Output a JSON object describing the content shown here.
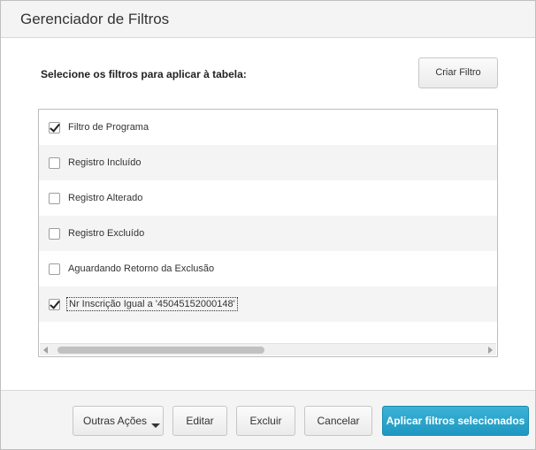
{
  "dialog": {
    "title": "Gerenciador de Filtros",
    "instruction": "Selecione os filtros para aplicar à tabela:",
    "create_button": "Criar Filtro"
  },
  "filters": [
    {
      "label": "Filtro de Programa",
      "checked": true
    },
    {
      "label": "Registro Incluído",
      "checked": false
    },
    {
      "label": "Registro Alterado",
      "checked": false
    },
    {
      "label": "Registro Excluído",
      "checked": false
    },
    {
      "label": "Aguardando Retorno da Exclusão",
      "checked": false
    },
    {
      "label": "Nr Inscrição Igual a '45045152000148'",
      "checked": true
    }
  ],
  "footer": {
    "more_actions": "Outras Ações",
    "edit": "Editar",
    "delete": "Excluir",
    "cancel": "Cancelar",
    "apply": "Aplicar filtros selecionados"
  },
  "colors": {
    "primary": "#2aa7cf",
    "header_bg": "#f4f4f4"
  }
}
